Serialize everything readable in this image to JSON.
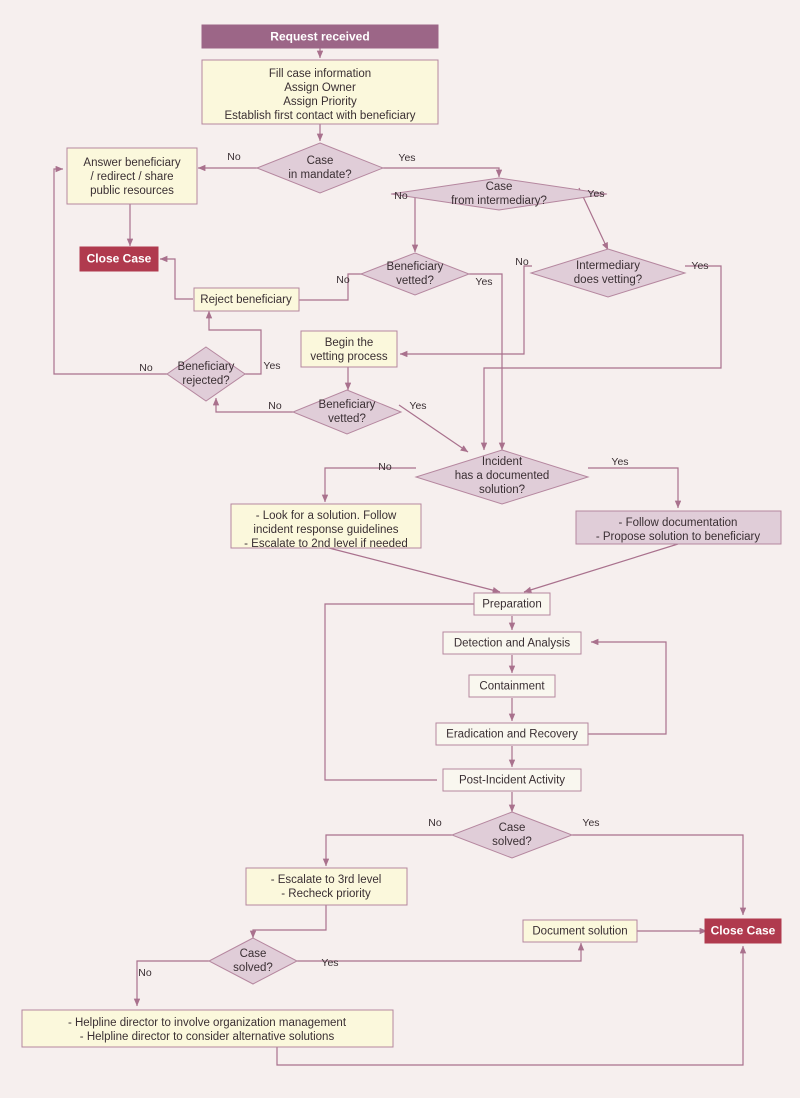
{
  "diagram": {
    "title": "Incident response case handling flowchart",
    "colors": {
      "background": "#f6efee",
      "header_fill": "#9c6687",
      "header_text": "#ffffff",
      "process_fill": "#fbf8dc",
      "process_stroke": "#b5879f",
      "decision_fill": "#e0cdd8",
      "decision_stroke": "#b5879f",
      "mauve_box_fill": "#e0cdd8",
      "terminator_fill": "#b03a4e",
      "terminator_text": "#ffffff",
      "edge_stroke": "#a9718d",
      "text": "#3a2f33"
    }
  },
  "nodes": {
    "request_received": {
      "label": "Request received",
      "type": "header"
    },
    "fill_case": {
      "type": "process",
      "lines": [
        "Fill case information",
        "Assign Owner",
        "Assign Priority",
        "Establish first contact with beneficiary"
      ]
    },
    "case_in_mandate": {
      "type": "decision",
      "lines": [
        "Case",
        "in mandate?"
      ]
    },
    "answer_beneficiary": {
      "type": "process",
      "lines": [
        "Answer beneficiary",
        "/ redirect / share",
        "public resources"
      ]
    },
    "close_case_top": {
      "label": "Close Case",
      "type": "terminator"
    },
    "case_from_intermediary": {
      "type": "decision",
      "lines": [
        "Case",
        "from intermediary?"
      ]
    },
    "beneficiary_vetted_1": {
      "type": "decision",
      "lines": [
        "Beneficiary",
        "vetted?"
      ]
    },
    "intermediary_does_vetting": {
      "type": "decision",
      "lines": [
        "Intermediary",
        "does vetting?"
      ]
    },
    "reject_beneficiary": {
      "type": "process",
      "lines": [
        "Reject beneficiary"
      ]
    },
    "beneficiary_rejected": {
      "type": "decision",
      "lines": [
        "Beneficiary",
        "rejected?"
      ]
    },
    "begin_vetting": {
      "type": "process",
      "lines": [
        "Begin the",
        "vetting process"
      ]
    },
    "beneficiary_vetted_2": {
      "type": "decision",
      "lines": [
        "Beneficiary",
        "vetted?"
      ]
    },
    "incident_documented": {
      "type": "decision",
      "lines": [
        "Incident",
        "has a documented",
        "solution?"
      ]
    },
    "look_for_solution": {
      "type": "process",
      "lines": [
        "- Look for a solution. Follow",
        "incident response guidelines",
        "- Escalate to 2nd level if needed"
      ]
    },
    "follow_documentation": {
      "type": "mauve_box",
      "lines": [
        "- Follow documentation",
        "- Propose solution to beneficiary"
      ]
    },
    "preparation": {
      "type": "process_plain",
      "lines": [
        "Preparation"
      ]
    },
    "detection_and_analysis": {
      "type": "process_plain",
      "lines": [
        "Detection and Analysis"
      ]
    },
    "containment": {
      "type": "process_plain",
      "lines": [
        "Containment"
      ]
    },
    "eradication_and_recovery": {
      "type": "process_plain",
      "lines": [
        "Eradication and Recovery"
      ]
    },
    "post_incident_activity": {
      "type": "process_plain",
      "lines": [
        "Post-Incident Activity"
      ]
    },
    "case_solved_1": {
      "type": "decision",
      "lines": [
        "Case",
        "solved?"
      ]
    },
    "escalate_3rd_level": {
      "type": "process",
      "lines": [
        "- Escalate to 3rd level",
        "- Recheck priority"
      ]
    },
    "case_solved_2": {
      "type": "decision",
      "lines": [
        "Case",
        "solved?"
      ]
    },
    "document_solution": {
      "type": "process",
      "lines": [
        "Document solution"
      ]
    },
    "close_case_bottom": {
      "label": "Close Case",
      "type": "terminator"
    },
    "helpline_director": {
      "type": "process",
      "lines": [
        "- Helpline director to involve organization management",
        "- Helpline director to consider alternative solutions"
      ]
    }
  },
  "edge_labels": {
    "mandate_no": "No",
    "mandate_yes": "Yes",
    "intermediary_no": "No",
    "intermediary_yes": "Yes",
    "vetted1_no": "No",
    "vetted1_yes": "Yes",
    "interm_vetting_no": "No",
    "interm_vetting_yes": "Yes",
    "rejected_no": "No",
    "rejected_yes": "Yes",
    "vetted2_no": "No",
    "vetted2_yes": "Yes",
    "documented_no": "No",
    "documented_yes": "Yes",
    "solved1_no": "No",
    "solved1_yes": "Yes",
    "solved2_no": "No",
    "solved2_yes": "Yes"
  }
}
